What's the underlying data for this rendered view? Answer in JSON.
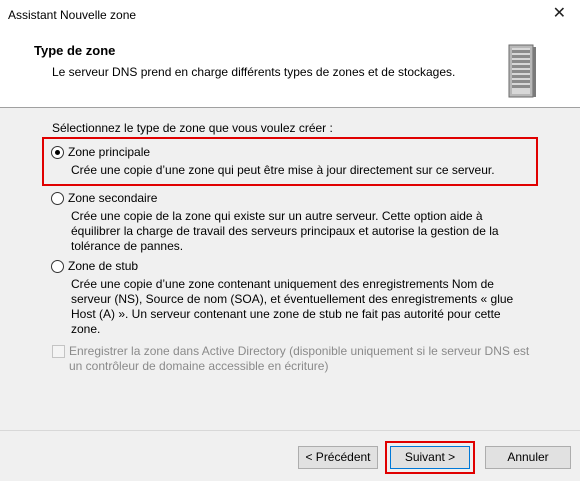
{
  "window": {
    "title": "Assistant Nouvelle zone",
    "close_glyph": "✕"
  },
  "header": {
    "title": "Type de zone",
    "description": "Le serveur DNS prend en charge différents types de zones et de stockages."
  },
  "prompt": "Sélectionnez le type de zone que vous voulez créer :",
  "options": [
    {
      "label": "Zone principale",
      "description": "Crée une copie d’une zone qui peut être mise à jour directement sur ce serveur.",
      "selected": true
    },
    {
      "label": "Zone secondaire",
      "description": "Crée une copie de la zone qui existe sur un autre serveur. Cette option aide à équilibrer la charge de travail des serveurs principaux et autorise la gestion de la tolérance de pannes.",
      "selected": false
    },
    {
      "label": "Zone de stub",
      "description": "Crée une copie d’une zone contenant uniquement des enregistrements Nom de serveur (NS), Source de nom (SOA), et éventuellement des enregistrements « glue Host (A) ». Un serveur contenant une zone de stub ne fait pas autorité pour cette zone.",
      "selected": false
    }
  ],
  "ad_checkbox": {
    "label": "Enregistrer la zone dans Active Directory (disponible uniquement si le serveur DNS est un contrôleur de domaine accessible en écriture)",
    "checked": false,
    "enabled": false
  },
  "buttons": {
    "previous": "< Précédent",
    "next": "Suivant >",
    "cancel": "Annuler"
  },
  "colors": {
    "highlight": "#e00000",
    "accent": "#0078d7"
  }
}
